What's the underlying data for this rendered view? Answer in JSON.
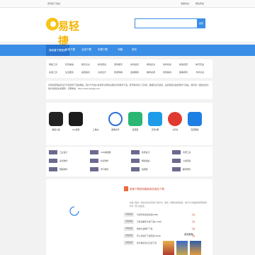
{
  "topbar": {
    "left": "易轻捷下载站",
    "right": [
      "收藏本站",
      "网站导航"
    ]
  },
  "logo": {
    "text": "易轻捷"
  },
  "search": {
    "button": "搜索"
  },
  "nav": [
    "易轻捷下载首页",
    "安卓下载",
    "合成下载",
    "苹果下载",
    "专题",
    "资讯"
  ],
  "cats": {
    "row1": [
      "网络工具",
      "影音播放",
      "聊天社交",
      "新闻阅读",
      "游戏娱乐",
      "休闲益智",
      "角色扮演",
      "动作射击",
      "模拟经营",
      "体育竞速"
    ],
    "row2": [
      "系统工具",
      "生活服务",
      "拍照美化",
      "交通出行",
      "旅游购物",
      "金融理财",
      "棋牌桌游",
      "冒险解谜",
      "策略塔防",
      "卡牌对战"
    ]
  },
  "intro": {
    "text": "易轻捷官网是专注于手机软件下载的网站，致力于为用户提供安全绿色免费的手机软件下载，所有软件经人工检测，确保无毒无插件，是您值得信赖的软件下载站，我们将一如既往的为用户提供最好的服务，官网地址：https://www.yiqingjie.com"
  },
  "apps": [
    {
      "name": "番茄小说",
      "color": "#222222",
      "icon": "book-icon"
    },
    {
      "name": "vivo应用",
      "color": "#1b1b1b",
      "icon": "vivo-icon"
    },
    {
      "name": "三角洲",
      "color": "#ffffff",
      "icon": "game-icon"
    },
    {
      "name": "酷狗音乐",
      "color": "#ffffff",
      "icon": "music-icon"
    },
    {
      "name": "应用宝",
      "color": "#2bb673",
      "icon": "store-icon"
    },
    {
      "name": "天天P图",
      "color": "#1e9be9",
      "icon": "photo-icon"
    },
    {
      "name": "小红书",
      "color": "#e0392f",
      "icon": "book-red-icon"
    },
    {
      "name": "百度网盘",
      "color": "#1d7ee3",
      "icon": "cloud-icon"
    }
  ],
  "tags": [
    [
      "工业设计",
      "CAD编辑器",
      "装修设计",
      "考研工具"
    ],
    [
      "读书软件",
      "外卖软件",
      "网络加速",
      "小说阅读"
    ],
    [
      "刷题软件",
      "学习软件",
      "短视频",
      "翻译软件"
    ]
  ],
  "article": {
    "title": "易速下载官网最新版安装包下载",
    "text": "易速下载是一款专业的安卓软件下载平台，收录了海量的优质资源，用户可以快速找到所需的软件并一键下载安装。"
  },
  "downloads": [
    {
      "tag": "手机游戏",
      "text": "可达鸭免费最新版(2MB)",
      "pct": "下载"
    },
    {
      "tag": "手机游戏",
      "text": "王者荣耀安卓版下载(1.2GB)",
      "pct": "下载"
    },
    {
      "tag": "手机游戏",
      "text": "植物大战僵尸下载",
      "pct": "下载"
    },
    {
      "tag": "手机游戏",
      "text": "开心消消乐下载安装(300M)",
      "pct": "下载"
    },
    {
      "tag": "手机游戏",
      "text": "和平精英官方正版下载",
      "pct": "下载"
    }
  ],
  "side": {
    "title": "游戏推荐"
  },
  "colors": {
    "nav": "#3a8ee6",
    "logo": "#f5b400",
    "accent": "#d2472f"
  }
}
